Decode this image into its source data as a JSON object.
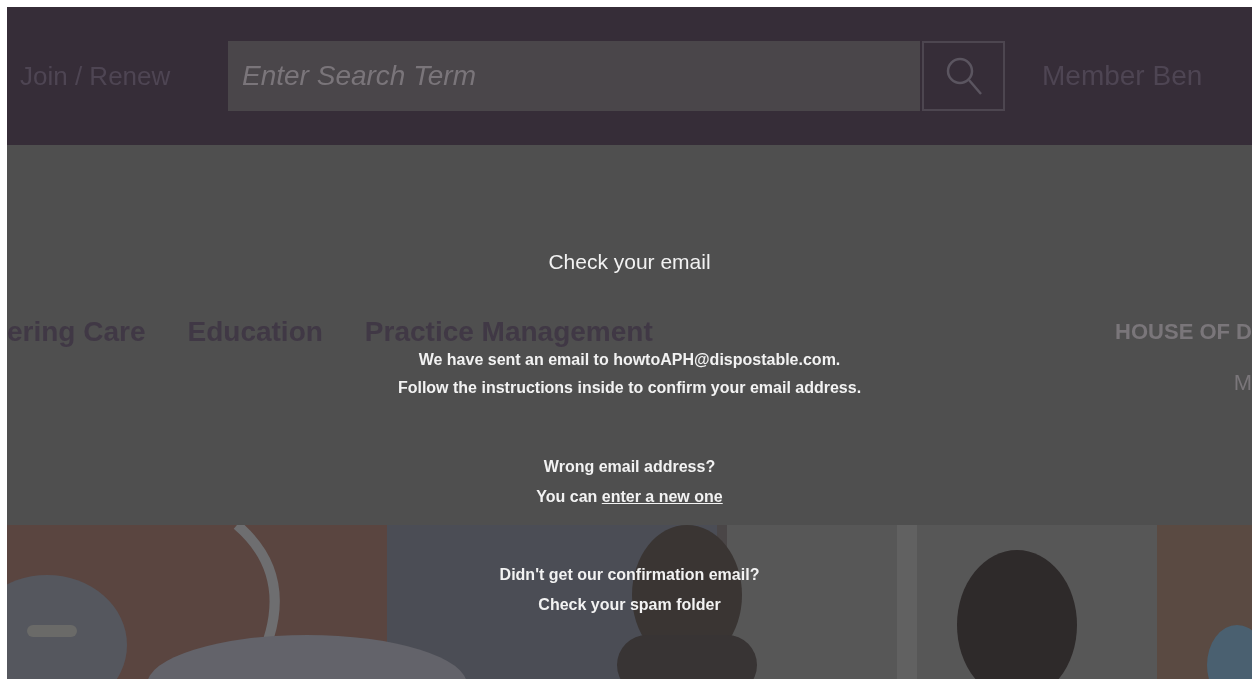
{
  "header": {
    "join_link": "Join / Renew",
    "search": {
      "placeholder": "Enter Search Term"
    },
    "member_link": "Member Ben"
  },
  "nav": {
    "items": [
      "ering Care",
      "Education",
      "Practice Management"
    ],
    "right_items": [
      "HOUSE OF D",
      "M"
    ]
  },
  "modal": {
    "title": "Check your email",
    "message": [
      "We have sent an email to howtoAPH@dispostable.com.",
      "Follow the instructions inside to confirm your email address."
    ],
    "wrong_email": {
      "question": "Wrong email address?",
      "prefix": "You can",
      "link": "enter a new one"
    },
    "no_email": {
      "question": "Didn't get our confirmation email?",
      "hint": "Check your spam folder"
    }
  }
}
